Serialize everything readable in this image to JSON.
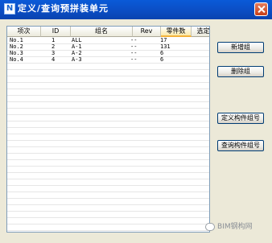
{
  "window": {
    "title": "定义/查询预拼装单元",
    "icon_label": "N"
  },
  "table": {
    "columns": [
      "项次",
      "ID",
      "组名",
      "Rev",
      "零件数",
      "选定"
    ],
    "rows": [
      {
        "item": "No.1",
        "id": "1",
        "group": "ALL",
        "rev": "--",
        "parts": "17",
        "selected": ""
      },
      {
        "item": "No.2",
        "id": "2",
        "group": "A-1",
        "rev": "--",
        "parts": "131",
        "selected": ""
      },
      {
        "item": "No.3",
        "id": "3",
        "group": "A-2",
        "rev": "--",
        "parts": "6",
        "selected": ""
      },
      {
        "item": "No.4",
        "id": "4",
        "group": "A-3",
        "rev": "--",
        "parts": "6",
        "selected": ""
      }
    ]
  },
  "buttons": {
    "add_group": "新增组",
    "delete_group": "删除组",
    "define_member_group": "定义构件组号",
    "query_member_group": "查询构件组号"
  },
  "watermark": {
    "text": "BIM钢构网"
  }
}
